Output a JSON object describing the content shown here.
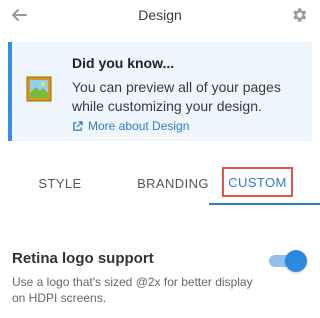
{
  "header": {
    "title": "Design",
    "back_icon": "arrow-left-icon",
    "settings_icon": "gear-icon"
  },
  "tip": {
    "title": "Did you know...",
    "body": "You can preview all of your pages while customizing your design.",
    "link": "More about Design",
    "icon": "image-frame-icon",
    "link_icon": "external-link-icon"
  },
  "tabs": [
    {
      "label": "STYLE",
      "active": false
    },
    {
      "label": "BRANDING",
      "active": false
    },
    {
      "label": "CUSTOM",
      "active": true
    }
  ],
  "setting": {
    "title": "Retina logo support",
    "description": "Use a logo that's sized @2x for better display on HDPI screens.",
    "enabled": true
  },
  "colors": {
    "accent": "#2a7fd4",
    "tip_background": "#eef5fc",
    "tab_highlight_border": "#e2544b"
  }
}
